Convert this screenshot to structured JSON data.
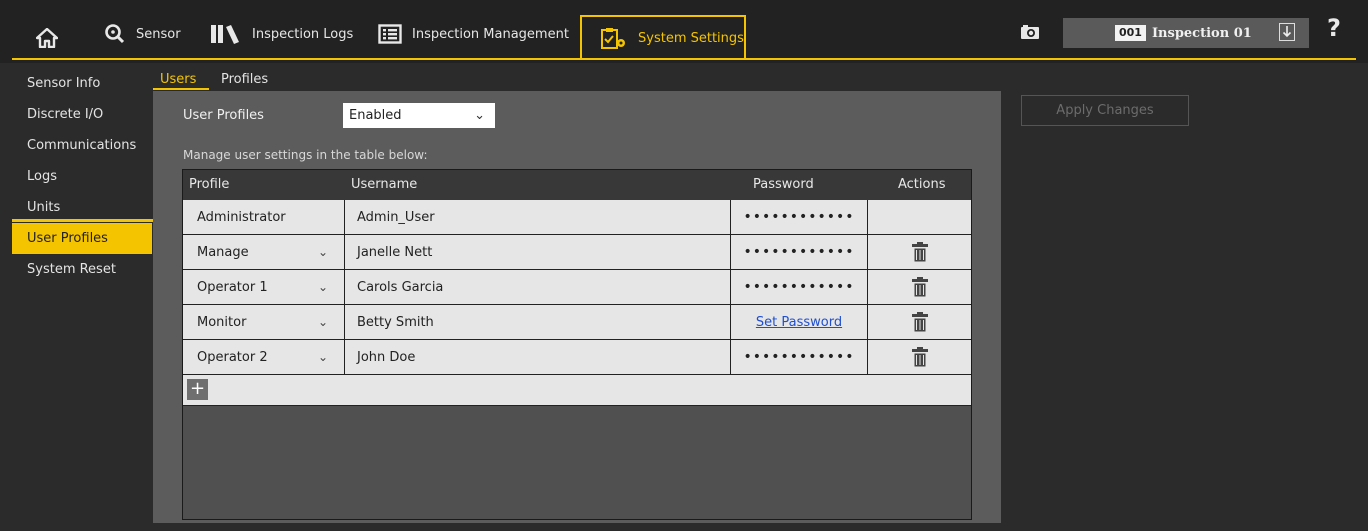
{
  "nav": {
    "home_icon": "home-icon",
    "sensor": "Sensor",
    "inspection_logs": "Inspection Logs",
    "inspection_management": "Inspection Management",
    "system_settings": "System Settings",
    "accent": "#f5c400"
  },
  "inspection": {
    "number": "001",
    "name": "Inspection 01"
  },
  "help": "?",
  "sidebar": {
    "items": [
      {
        "label": "Sensor Info"
      },
      {
        "label": "Discrete I/O"
      },
      {
        "label": "Communications"
      },
      {
        "label": "Logs"
      },
      {
        "label": "Units"
      },
      {
        "label": "User Profiles"
      },
      {
        "label": "System Reset"
      }
    ],
    "active": "User Profiles"
  },
  "tabs": {
    "users": "Users",
    "profiles": "Profiles",
    "active": "Users"
  },
  "user_profiles": {
    "label": "User Profiles",
    "value": "Enabled"
  },
  "manage_text": "Manage user settings in the table below:",
  "table": {
    "headers": {
      "profile": "Profile",
      "username": "Username",
      "password": "Password",
      "actions": "Actions"
    },
    "rows": [
      {
        "profile": "Administrator",
        "username": "Admin_User",
        "password": "••••••••••••"
      },
      {
        "profile": "Manage",
        "username": "Janelle Nett",
        "password": "••••••••••••"
      },
      {
        "profile": "Operator 1",
        "username": "Carols Garcia",
        "password": "••••••••••••"
      },
      {
        "profile": "Monitor",
        "username": "Betty Smith",
        "password": "Set Password"
      },
      {
        "profile": "Operator 2",
        "username": "John Doe",
        "password": "••••••••••••"
      }
    ],
    "add": "+"
  },
  "apply_button": "Apply Changes"
}
